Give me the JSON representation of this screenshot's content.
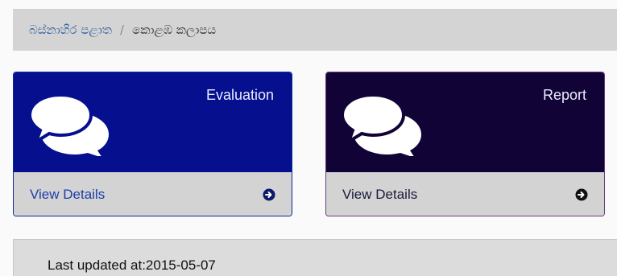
{
  "breadcrumb": {
    "parent": "බස්නාහිර පළාත",
    "separator": "/",
    "current": "කොළඹ කලාපය"
  },
  "panels": [
    {
      "title": "Evaluation",
      "footer_label": "View Details",
      "icon": "comments-icon",
      "footer_icon": "arrow-circle-right-icon",
      "color": "#06108f"
    },
    {
      "title": "Report",
      "footer_label": "View Details",
      "icon": "comments-icon",
      "footer_icon": "arrow-circle-right-icon",
      "color": "#120336"
    }
  ],
  "info": {
    "last_updated": "Last updated at:2015-05-07"
  }
}
